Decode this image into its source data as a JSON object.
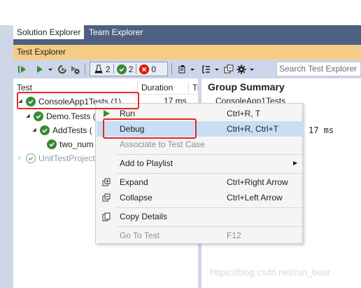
{
  "tabs": [
    {
      "label": "Solution Explorer",
      "active": true
    },
    {
      "label": "Team Explorer",
      "active": false
    }
  ],
  "panel_title": "Test Explorer",
  "toolbar": {
    "run_all_icon": "run-all-icon",
    "run_icon": "run-icon",
    "refresh_icon": "rerun-icon",
    "cancel_icon": "cancel-icon",
    "total_count": "2",
    "passed_count": "2",
    "failed_count": "0",
    "search_placeholder": "Search Test Explorer"
  },
  "columns": {
    "test": "Test",
    "duration": "Duration",
    "traits": "Tr"
  },
  "tree": [
    {
      "label": "ConsoleApp1Tests (1)",
      "duration": "17 ms",
      "level": 0,
      "expanded": true
    },
    {
      "label": "Demo.Tests (",
      "level": 1,
      "expanded": true
    },
    {
      "label": "AddTests (",
      "level": 2,
      "expanded": true
    },
    {
      "label": "two_num",
      "level": 3
    },
    {
      "label": "UnitTestProject",
      "level": 0,
      "expanded": false
    }
  ],
  "summary": {
    "title": "Group Summary",
    "partial_name": "ConsoleApp1Tests",
    "duration": "17 ms"
  },
  "context_menu": [
    {
      "label": "Run",
      "shortcut": "Ctrl+R, T",
      "icon": "play-icon"
    },
    {
      "label": "Debug",
      "shortcut": "Ctrl+R, Ctrl+T",
      "highlighted": true
    },
    {
      "label": "Associate to Test Case",
      "disabled": true
    },
    {
      "label": "Add to Playlist",
      "submenu": true
    },
    {
      "label": "Expand",
      "shortcut": "Ctrl+Right Arrow",
      "icon": "expand-icon"
    },
    {
      "label": "Collapse",
      "shortcut": "Ctrl+Left Arrow",
      "icon": "collapse-icon"
    },
    {
      "label": "Copy Details",
      "icon": "copy-icon"
    },
    {
      "label": "Go To Test",
      "shortcut": "F12",
      "disabled": true
    }
  ],
  "watermark": "https://blog.csdn.net/run_bear",
  "colors": {
    "tabbar": "#4d6082",
    "panel_title": "#f5cc84",
    "toolbar": "#ccd5e9",
    "pass_green": "#388a34",
    "fail_red": "#e51400",
    "highlight_box": "#e8281f",
    "menu_hover": "#c9def5"
  }
}
